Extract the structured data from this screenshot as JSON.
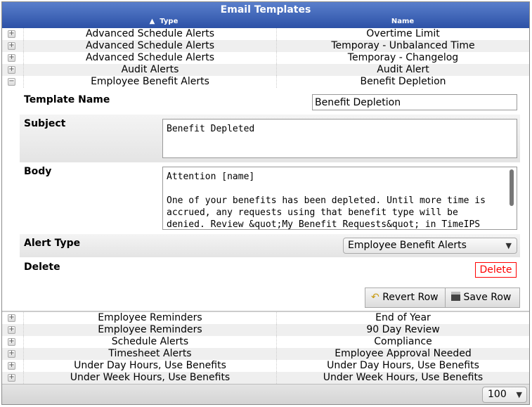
{
  "title": "Email Templates",
  "columns": {
    "type": "Type",
    "name": "Name",
    "sort_indicator": "▲"
  },
  "rows_top": [
    {
      "type": "Advanced Schedule Alerts",
      "name": "Overtime Limit"
    },
    {
      "type": "Advanced Schedule Alerts",
      "name": "Temporay - Unbalanced Time"
    },
    {
      "type": "Advanced Schedule Alerts",
      "name": "Temporay - Changelog"
    },
    {
      "type": "Audit Alerts",
      "name": "Audit Alert"
    },
    {
      "type": "Employee Benefit Alerts",
      "name": "Benefit Depletion"
    }
  ],
  "detail": {
    "template_name_label": "Template Name",
    "template_name_value": "Benefit Depletion",
    "subject_label": "Subject",
    "subject_value": "Benefit Depleted",
    "body_label": "Body",
    "body_value": "Attention [name]\n\nOne of your benefits has been depleted. Until more time is\naccrued, any requests using that benefit type will be\ndenied. Review &quot;My Benefit Requests&quot; in TimeIPS",
    "alert_type_label": "Alert Type",
    "alert_type_value": "Employee Benefit Alerts",
    "delete_label": "Delete",
    "delete_button": "Delete",
    "revert_button": "Revert Row",
    "save_button": "Save Row"
  },
  "rows_bottom": [
    {
      "type": "Employee Reminders",
      "name": "End of Year"
    },
    {
      "type": "Employee Reminders",
      "name": "90 Day Review"
    },
    {
      "type": "Schedule Alerts",
      "name": "Compliance"
    },
    {
      "type": "Timesheet Alerts",
      "name": "Employee Approval Needed"
    },
    {
      "type": "Under Day Hours, Use Benefits",
      "name": "Under Day Hours, Use Benefits"
    },
    {
      "type": "Under Week Hours, Use Benefits",
      "name": "Under Week Hours, Use Benefits"
    }
  ],
  "page_size": "100",
  "colors": {
    "header": "#3a5fb5",
    "delete": "#ff0000"
  }
}
